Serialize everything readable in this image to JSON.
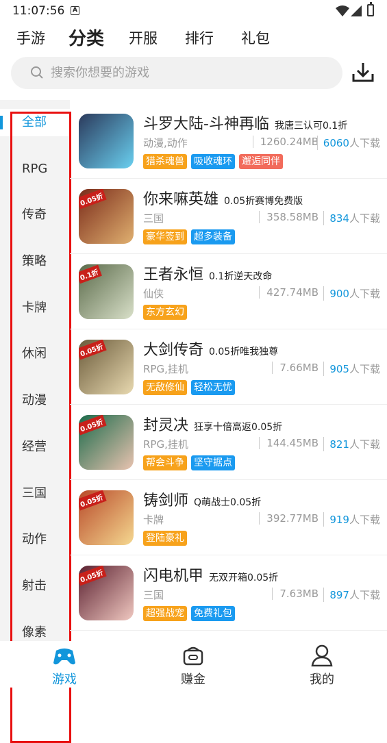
{
  "status": {
    "time": "11:07:56",
    "a_icon": "A"
  },
  "tabs": [
    {
      "label": "手游"
    },
    {
      "label": "分类"
    },
    {
      "label": "开服"
    },
    {
      "label": "排行"
    },
    {
      "label": "礼包"
    }
  ],
  "active_tab": "分类",
  "search": {
    "placeholder": "搜索你想要的游戏",
    "icon": "search-icon"
  },
  "download_icon": "download-icon",
  "categories": [
    "全部",
    "RPG",
    "传奇",
    "策略",
    "卡牌",
    "休闲",
    "动漫",
    "经营",
    "三国",
    "动作",
    "射击",
    "像素"
  ],
  "active_category": "全部",
  "games": [
    {
      "name": "斗罗大陆-斗神再临",
      "promo": "我唐三认可0.1折",
      "genre": "动漫,动作",
      "size": "1260.24MB",
      "downloads": "6060",
      "dl_suffix": "人下载",
      "tags": [
        {
          "t": "猎杀魂兽",
          "c": "#f7a21b"
        },
        {
          "t": "吸收魂环",
          "c": "#1a9af0"
        },
        {
          "t": "邂逅同伴",
          "c": "#f26b5b"
        }
      ],
      "icon_colors": [
        "#2b3a5c",
        "#6ad0f0"
      ]
    },
    {
      "name": "你来嘛英雄",
      "promo": "0.05折赛博免费版",
      "genre": "三国",
      "size": "358.58MB",
      "downloads": "834",
      "dl_suffix": "人下载",
      "tags": [
        {
          "t": "豪华签到",
          "c": "#f7a21b"
        },
        {
          "t": "超多装备",
          "c": "#1a9af0"
        }
      ],
      "icon_colors": [
        "#7a2b1a",
        "#e0b070"
      ],
      "badge": "0.05折"
    },
    {
      "name": "王者永恒",
      "promo": "0.1折逆天改命",
      "genre": "仙侠",
      "size": "427.74MB",
      "downloads": "900",
      "dl_suffix": "人下载",
      "tags": [
        {
          "t": "东方玄幻",
          "c": "#f7a21b"
        }
      ],
      "icon_colors": [
        "#5a6a4a",
        "#d9e0c9"
      ],
      "badge": "0.1折"
    },
    {
      "name": "大剑传奇",
      "promo": "0.05折唯我独尊",
      "genre": "RPG,挂机",
      "size": "7.66MB",
      "downloads": "905",
      "dl_suffix": "人下载",
      "tags": [
        {
          "t": "无敌修仙",
          "c": "#f7a21b"
        },
        {
          "t": "轻松无忧",
          "c": "#1a9af0"
        }
      ],
      "icon_colors": [
        "#6a5a3a",
        "#e8d9b0"
      ],
      "badge": "0.05折"
    },
    {
      "name": "封灵决",
      "promo": "狂享十倍高返0.05折",
      "genre": "RPG,挂机",
      "size": "144.45MB",
      "downloads": "821",
      "dl_suffix": "人下载",
      "tags": [
        {
          "t": "帮会斗争",
          "c": "#f7a21b"
        },
        {
          "t": "坚守据点",
          "c": "#1a9af0"
        }
      ],
      "icon_colors": [
        "#1a6a4a",
        "#e9c3b0"
      ],
      "badge": "0.05折"
    },
    {
      "name": "铸剑师",
      "promo": "Q萌战士0.05折",
      "genre": "卡牌",
      "size": "392.77MB",
      "downloads": "919",
      "dl_suffix": "人下载",
      "tags": [
        {
          "t": "登陆豪礼",
          "c": "#f7a21b"
        }
      ],
      "icon_colors": [
        "#b84a2a",
        "#f5d890"
      ],
      "badge": "0.05折"
    },
    {
      "name": "闪电机甲",
      "promo": "无双开箱0.05折",
      "genre": "三国",
      "size": "7.63MB",
      "downloads": "897",
      "dl_suffix": "人下载",
      "tags": [
        {
          "t": "超强战宠",
          "c": "#f7a21b"
        },
        {
          "t": "免费礼包",
          "c": "#1a9af0"
        }
      ],
      "icon_colors": [
        "#5a2030",
        "#f0c8c0"
      ],
      "badge": "0.05折"
    }
  ],
  "bottom_nav": [
    {
      "label": "游戏",
      "icon": "gamepad-icon"
    },
    {
      "label": "赚金",
      "icon": "coin-box-icon"
    },
    {
      "label": "我的",
      "icon": "user-icon"
    }
  ],
  "active_bottom": "游戏"
}
